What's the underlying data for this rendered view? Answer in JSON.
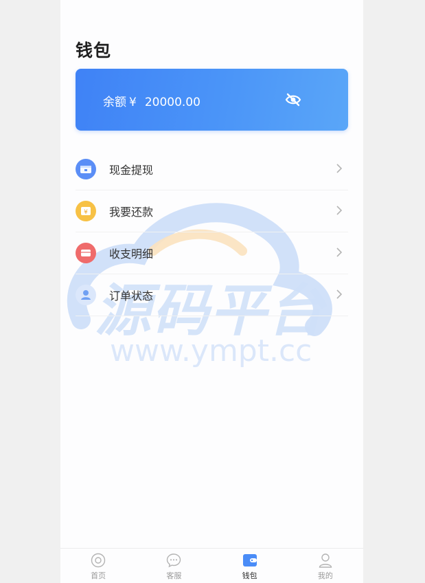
{
  "header": {
    "title": "钱包"
  },
  "balance": {
    "label": "余额",
    "currency": "¥",
    "amount": "20000.00",
    "toggle_icon": "eye-off-icon",
    "gradient_start": "#3f82f6",
    "gradient_end": "#5aa6f8"
  },
  "menu": {
    "items": [
      {
        "label": "现金提现",
        "icon": "cash-withdraw-icon",
        "color": "#5b8ef6"
      },
      {
        "label": "我要还款",
        "icon": "repay-icon",
        "color": "#f7c145"
      },
      {
        "label": "收支明细",
        "icon": "details-icon",
        "color": "#ef6b6b"
      },
      {
        "label": "订单状态",
        "icon": "order-status-icon",
        "color": "#6fa0f3"
      }
    ]
  },
  "watermark": {
    "text_main": "源码平台",
    "text_url": "www.ympt.cc"
  },
  "tabbar": {
    "items": [
      {
        "label": "首页",
        "icon": "home-icon"
      },
      {
        "label": "客服",
        "icon": "chat-icon"
      },
      {
        "label": "钱包",
        "icon": "wallet-icon",
        "active": true
      },
      {
        "label": "我的",
        "icon": "user-icon"
      }
    ]
  }
}
